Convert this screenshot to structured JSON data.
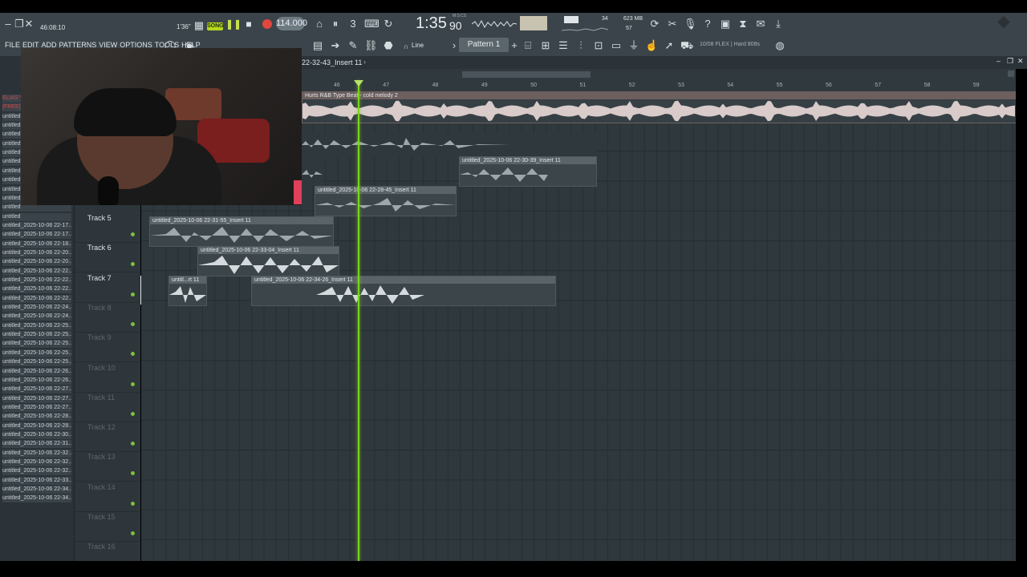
{
  "app": {
    "clock": "46:08:10",
    "transport_mode": "SONG",
    "tempo": "114.000",
    "song_time": "1:35",
    "song_time_frac": "90",
    "song_time_label": "M:S:CS",
    "cpu_value": "34",
    "ram": "623 MB",
    "ram_sub": "57",
    "beat_time": "1'36\"",
    "pattern_name": "Pattern 1",
    "snap_mode": "Line",
    "hint_text": "10/08  FLEX | Hard 808s",
    "window_title": "22-32-43_Insert 11"
  },
  "menu": {
    "items": [
      "FILE",
      "EDIT",
      "ADD",
      "PATTERNS",
      "VIEW",
      "OPTIONS",
      "TOOLS",
      "HELP"
    ]
  },
  "browser": {
    "items": [
      "ELIAS V",
      "[FREE]",
      "untitled",
      "untitled",
      "untitled",
      "untitled",
      "untitled",
      "untitled",
      "untitled",
      "untitled",
      "untitled",
      "untitled",
      "untitled",
      "untitled",
      "untitled_2025-10-06 22-17..",
      "untitled_2025-10-06 22-17..",
      "untitled_2025-10-06 22-18..",
      "untitled_2025-10-06 22-20..",
      "untitled_2025-10-06 22-20..",
      "untitled_2025-10-06 22-22..",
      "untitled_2025-10-06 22-22..",
      "untitled_2025-10-06 22-22..",
      "untitled_2025-10-06 22-22..",
      "untitled_2025-10-06 22-24..",
      "untitled_2025-10-06 22-24..",
      "untitled_2025-10-06 22-25..",
      "untitled_2025-10-06 22-25..",
      "untitled_2025-10-06 22-25..",
      "untitled_2025-10-06 22-25..",
      "untitled_2025-10-06 22-25..",
      "untitled_2025-10-06 22-26..",
      "untitled_2025-10-06 22-26..",
      "untitled_2025-10-06 22-27..",
      "untitled_2025-10-06 22-27..",
      "untitled_2025-10-06 22-27..",
      "untitled_2025-10-06 22-28..",
      "untitled_2025-10-06 22-28..",
      "untitled_2025-10-06 22-30..",
      "untitled_2025-10-06 22-31..",
      "untitled_2025-10-06 22-32..",
      "untitled_2025-10-06 22-32..",
      "untitled_2025-10-06 22-32..",
      "untitled_2025-10-06 22-33..",
      "untitled_2025-10-06 22-34..",
      "untitled_2025-10-06 22-34.."
    ]
  },
  "timeline": {
    "bars": [
      "46",
      "47",
      "48",
      "49",
      "50",
      "51",
      "52",
      "53",
      "54",
      "55",
      "56",
      "57",
      "58",
      "59"
    ]
  },
  "tracks": [
    {
      "name": "Track 5",
      "active": true
    },
    {
      "name": "Track 6",
      "active": true
    },
    {
      "name": "Track 7",
      "active": true
    },
    {
      "name": "Track 8",
      "active": false
    },
    {
      "name": "Track 9",
      "active": false
    },
    {
      "name": "Track 10",
      "active": false
    },
    {
      "name": "Track 11",
      "active": false
    },
    {
      "name": "Track 12",
      "active": false
    },
    {
      "name": "Track 13",
      "active": false
    },
    {
      "name": "Track 14",
      "active": false
    },
    {
      "name": "Track 15",
      "active": false
    },
    {
      "name": "Track 16",
      "active": false
    }
  ],
  "clips": {
    "melody": "Hurts  R&B Type Beat - cold melody 2",
    "c1": "untitled_2025-10-06 22-30-39_Insert 11",
    "c2": "untitled_2025-10-06 22-28-45_Insert 11",
    "c3": "untitled_2025-10-06 22-31-55_Insert 11",
    "c4": "untitled_2025-10-06 22-33-04_Insert 11",
    "c5": "untitl...rt 11",
    "c6": "untitled_2025-10-06 22-34-26_Insert 11"
  },
  "colors": {
    "playhead": "#7ed321",
    "song_led": "#b6d81a",
    "record": "#e0473d",
    "track_bg": "#2f383d"
  }
}
